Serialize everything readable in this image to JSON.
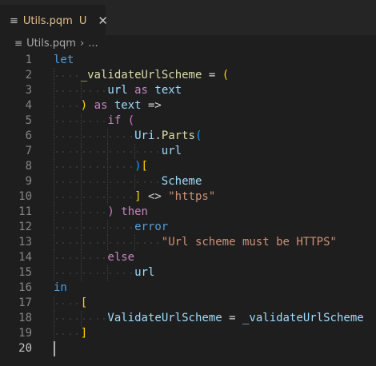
{
  "tab": {
    "icon": "menu-lines-icon",
    "title": "Utils.pqm",
    "badge": "U",
    "close": "✕"
  },
  "breadcrumb": {
    "icon": "menu-lines-icon",
    "file": "Utils.pqm",
    "separator": "›",
    "more": "..."
  },
  "colors": {
    "keyword": "#569cd6",
    "control": "#c586c0",
    "identifier": "#9cdcfe",
    "function": "#dcdcaa",
    "string": "#ce9178",
    "bracket1": "#ffd700",
    "bracket2": "#da70d6",
    "bracket3": "#179fff"
  },
  "lines": [
    {
      "n": "1",
      "indent": 0,
      "tokens": [
        [
          "kw",
          "let"
        ]
      ]
    },
    {
      "n": "2",
      "indent": 1,
      "tokens": [
        [
          "fn",
          "_validateUrlScheme"
        ],
        [
          "op",
          " = "
        ],
        [
          "br1",
          "("
        ]
      ]
    },
    {
      "n": "3",
      "indent": 2,
      "tokens": [
        [
          "id",
          "url"
        ],
        [
          "op",
          " "
        ],
        [
          "kw2",
          "as"
        ],
        [
          "op",
          " "
        ],
        [
          "id",
          "text"
        ]
      ]
    },
    {
      "n": "4",
      "indent": 1,
      "tokens": [
        [
          "br1",
          ")"
        ],
        [
          "op",
          " "
        ],
        [
          "kw2",
          "as"
        ],
        [
          "op",
          " "
        ],
        [
          "id",
          "text"
        ],
        [
          "op",
          " =>"
        ]
      ]
    },
    {
      "n": "5",
      "indent": 2,
      "tokens": [
        [
          "kw2",
          "if"
        ],
        [
          "op",
          " "
        ],
        [
          "br2",
          "("
        ]
      ]
    },
    {
      "n": "6",
      "indent": 3,
      "tokens": [
        [
          "id",
          "Uri"
        ],
        [
          "op",
          "."
        ],
        [
          "fn",
          "Parts"
        ],
        [
          "br3",
          "("
        ]
      ]
    },
    {
      "n": "7",
      "indent": 4,
      "tokens": [
        [
          "id",
          "url"
        ]
      ]
    },
    {
      "n": "8",
      "indent": 3,
      "tokens": [
        [
          "br3",
          ")"
        ],
        [
          "br1",
          "["
        ]
      ]
    },
    {
      "n": "9",
      "indent": 4,
      "tokens": [
        [
          "id",
          "Scheme"
        ]
      ]
    },
    {
      "n": "10",
      "indent": 3,
      "tokens": [
        [
          "br1",
          "]"
        ],
        [
          "op",
          " <> "
        ],
        [
          "str",
          "\"https\""
        ]
      ]
    },
    {
      "n": "11",
      "indent": 2,
      "tokens": [
        [
          "br2",
          ")"
        ],
        [
          "op",
          " "
        ],
        [
          "kw2",
          "then"
        ]
      ]
    },
    {
      "n": "12",
      "indent": 3,
      "tokens": [
        [
          "kw",
          "error"
        ]
      ]
    },
    {
      "n": "13",
      "indent": 4,
      "tokens": [
        [
          "str",
          "\"Url scheme must be HTTPS\""
        ]
      ]
    },
    {
      "n": "14",
      "indent": 2,
      "tokens": [
        [
          "kw2",
          "else"
        ]
      ]
    },
    {
      "n": "15",
      "indent": 3,
      "tokens": [
        [
          "id",
          "url"
        ]
      ]
    },
    {
      "n": "16",
      "indent": 0,
      "tokens": [
        [
          "kw",
          "in"
        ]
      ]
    },
    {
      "n": "17",
      "indent": 1,
      "tokens": [
        [
          "br1",
          "["
        ]
      ]
    },
    {
      "n": "18",
      "indent": 2,
      "tokens": [
        [
          "id",
          "ValidateUrlScheme"
        ],
        [
          "op",
          " = "
        ],
        [
          "id",
          "_validateUrlScheme"
        ]
      ]
    },
    {
      "n": "19",
      "indent": 1,
      "tokens": [
        [
          "br1",
          "]"
        ]
      ]
    },
    {
      "n": "20",
      "indent": 0,
      "tokens": [],
      "active": true
    }
  ]
}
